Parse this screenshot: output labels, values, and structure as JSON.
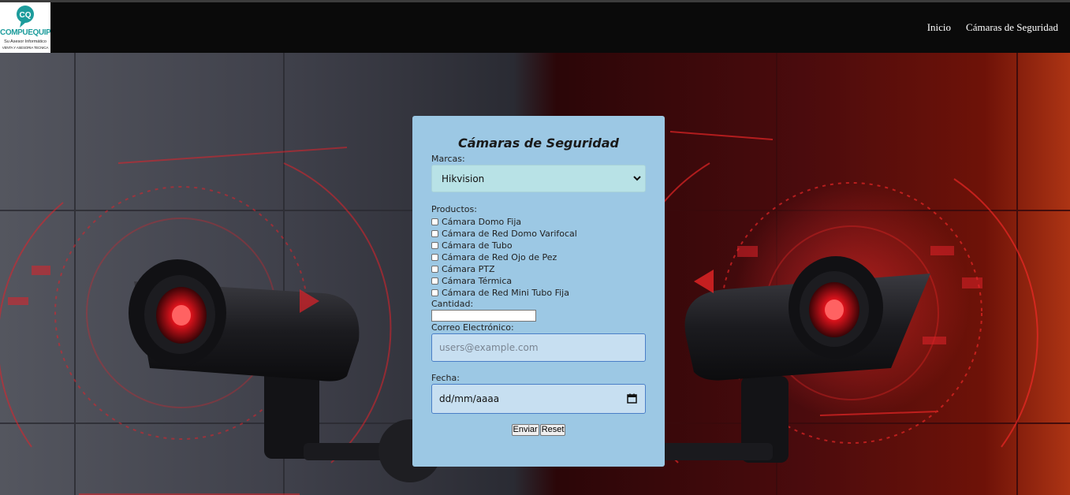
{
  "brand": {
    "logo_letters": "CQ",
    "name": "COMPUEQUIPA",
    "tagline": "Su Asesor Informático",
    "sub_tagline": "VENTA Y ASESORIA TECNICA"
  },
  "nav": {
    "items": [
      {
        "label": "Inicio"
      },
      {
        "label": "Cámaras de Seguridad"
      }
    ]
  },
  "form": {
    "title": "Cámaras de Seguridad",
    "marcas_label": "Marcas:",
    "marcas_value": "Hikvision",
    "productos_label": "Productos:",
    "productos": [
      {
        "label": "Cámara Domo Fija",
        "checked": false
      },
      {
        "label": "Cámara de Red Domo Varifocal",
        "checked": false
      },
      {
        "label": "Cámara de Tubo",
        "checked": false
      },
      {
        "label": "Cámara de Red Ojo de Pez",
        "checked": false
      },
      {
        "label": "Cámara PTZ",
        "checked": false
      },
      {
        "label": "Cámara Térmica",
        "checked": false
      },
      {
        "label": "Cámara de Red Mini Tubo Fija",
        "checked": false
      }
    ],
    "cantidad_label": "Cantidad:",
    "cantidad_value": "",
    "correo_label": "Correo Electrónico:",
    "correo_placeholder": "users@example.com",
    "fecha_label": "Fecha:",
    "fecha_placeholder": "dd/mm/aaaa",
    "submit_label": "Enviar",
    "reset_label": "Reset"
  },
  "colors": {
    "navbar": "#0a0a0a",
    "panel": "#9cc8e4",
    "select_bg": "#b8e2e6",
    "input_bg": "#c7dff1",
    "input_border": "#4a7fc7",
    "brand_teal": "#1d9c9c",
    "hero_red": "#e0222a"
  },
  "icons": {
    "logo": "cq-speech-bubble-icon",
    "select_chevron": "chevron-down-icon",
    "calendar": "calendar-icon"
  }
}
